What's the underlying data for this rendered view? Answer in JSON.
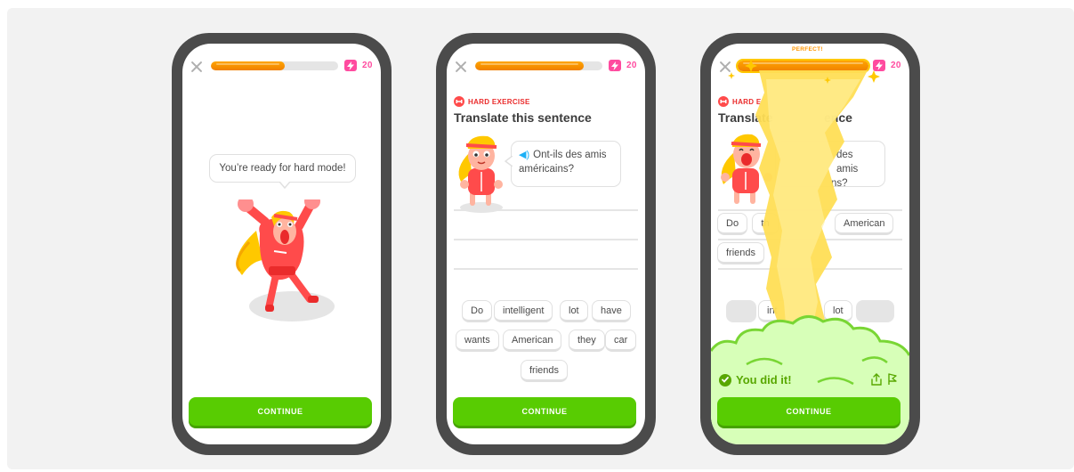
{
  "progress_color": "#ff9600",
  "accent_green": "#58cc02",
  "energy_color": "#ff4b9f",
  "screens": [
    {
      "progress": 0.58,
      "energy": "20",
      "speech": "You’re ready for hard mode!",
      "continue_label": "CONTINUE"
    },
    {
      "progress": 0.85,
      "energy": "20",
      "hard_label": "HARD EXERCISE",
      "title": "Translate this sentence",
      "prompt_line1": "Ont-ils des amis",
      "prompt_line2": "américains?",
      "word_bank": [
        "Do",
        "intelligent",
        "lot",
        "have",
        "wants",
        "American",
        "they",
        "car",
        "friends"
      ],
      "continue_label": "CONTINUE"
    },
    {
      "progress": 1.0,
      "energy": "20",
      "perfect_label": "PERFECT!",
      "hard_label": "HARD E",
      "title": "Translate",
      "title_end": "ence",
      "prompt_line1_end": "des amis",
      "prompt_line2_end": "ns?",
      "answer_chips": [
        "Do",
        "th",
        "American",
        "friends"
      ],
      "bank_chips": [
        "int",
        "lot"
      ],
      "success_text": "You did it!",
      "continue_label": "CONTINUE"
    }
  ]
}
